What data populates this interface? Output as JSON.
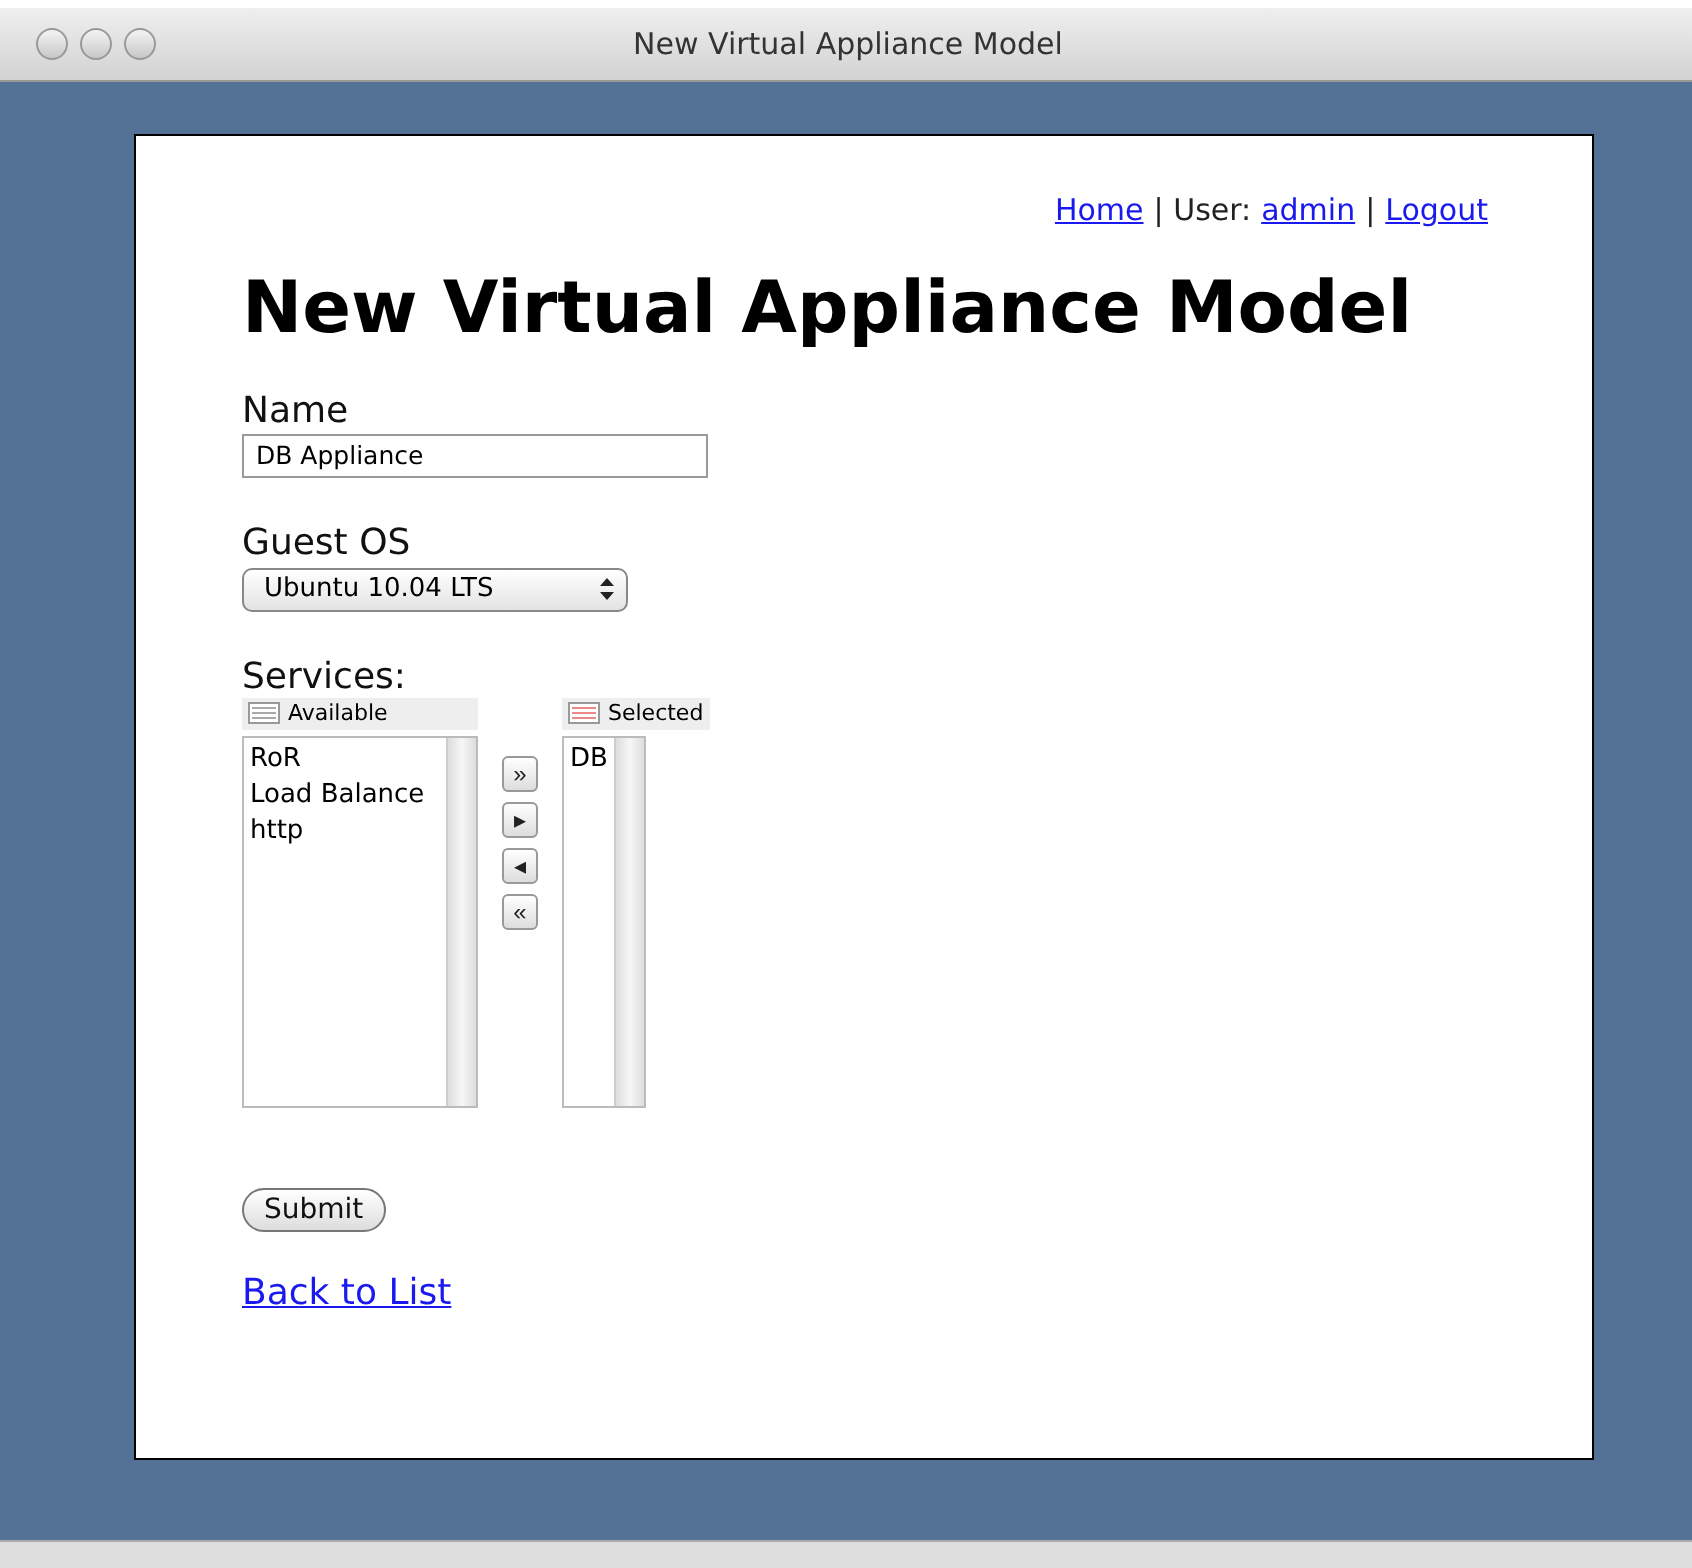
{
  "window": {
    "title": "New Virtual Appliance Model"
  },
  "nav": [
    {
      "kind": "link",
      "text": "Home"
    },
    {
      "kind": "text",
      "text": "| User:"
    },
    {
      "kind": "link",
      "text": "admin"
    },
    {
      "kind": "text",
      "text": "|"
    },
    {
      "kind": "link",
      "text": "Logout"
    }
  ],
  "heading": "New Virtual Appliance Model",
  "name_field": {
    "label": "Name",
    "value": "DB Appliance"
  },
  "guest_os": {
    "label": "Guest OS",
    "value": "Ubuntu 10.04 LTS"
  },
  "services": {
    "label": "Services:",
    "available": {
      "header": "Available",
      "items": [
        "RoR",
        "Load Balance",
        "http"
      ]
    },
    "move_buttons": [
      "»",
      "▸",
      "◂",
      "«"
    ],
    "selected": {
      "header": "Selected",
      "items": [
        "DB"
      ]
    }
  },
  "submit": "Submit",
  "back_link": "Back to List"
}
